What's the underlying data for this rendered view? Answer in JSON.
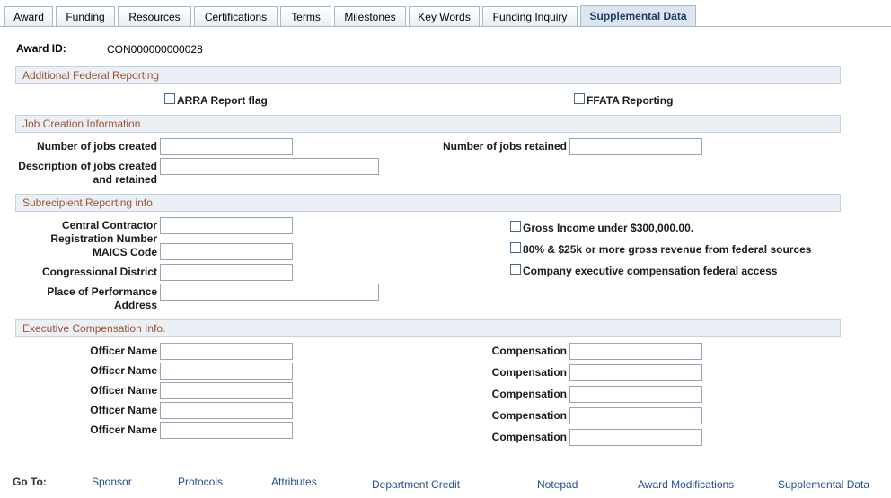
{
  "tabs": [
    {
      "label": "Award"
    },
    {
      "label": "Funding"
    },
    {
      "label": "Resources"
    },
    {
      "label": "Certifications"
    },
    {
      "label": "Terms"
    },
    {
      "label": "Milestones"
    },
    {
      "label": "Key Words"
    },
    {
      "label": "Funding Inquiry"
    },
    {
      "label": "Supplemental Data"
    }
  ],
  "award": {
    "label": "Award ID:",
    "value": "CON000000000028"
  },
  "sections": {
    "federal": "Additional Federal Reporting",
    "jobs": "Job Creation Information",
    "subrecipient": "Subrecipient Reporting info.",
    "exec": "Executive Compensation Info."
  },
  "federal": {
    "arra": "ARRA Report flag",
    "ffata": "FFATA Reporting"
  },
  "jobs": {
    "created": "Number of jobs created",
    "retained": "Number of jobs retained",
    "desc_line1": "Description of jobs created",
    "desc_line2": "and retained"
  },
  "subrecipient": {
    "ccr_line1": "Central Contractor",
    "ccr_line2": "Registration Number",
    "naics": "MAICS Code",
    "district": "Congressional District",
    "place_line1": "Place of Performance",
    "place_line2": "Address",
    "gross_income": "Gross Income under $300,000.00.",
    "revenue": "80% & $25k or more gross revenue from federal sources",
    "exec_access": "Company executive compensation federal access"
  },
  "exec": {
    "officer_label": "Officer Name",
    "comp_label": "Compensation"
  },
  "goto": {
    "label": "Go To:",
    "links": [
      "Sponsor",
      "Protocols",
      "Attributes",
      "Department Credit",
      "Notepad",
      "Award Modifications",
      "Supplemental Data"
    ]
  }
}
